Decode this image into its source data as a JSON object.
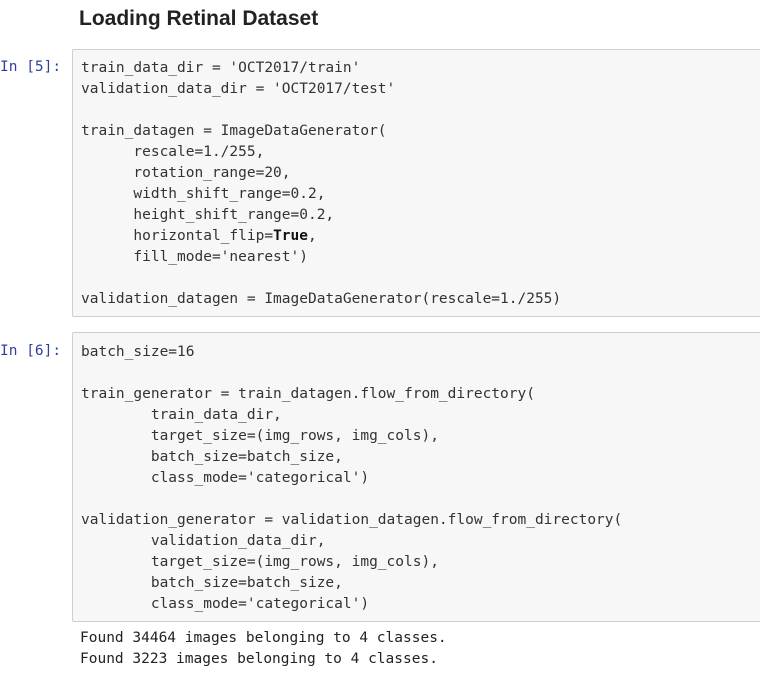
{
  "heading": "Loading Retinal Dataset",
  "cells": [
    {
      "prompt": "In [5]:",
      "lines": [
        "train_data_dir = 'OCT2017/train'",
        "validation_data_dir = 'OCT2017/test'",
        "",
        "train_datagen = ImageDataGenerator(",
        "      rescale=1./255,",
        "      rotation_range=20,",
        "      width_shift_range=0.2,",
        "      height_shift_range=0.2,",
        "      horizontal_flip=",
        "      fill_mode='nearest')",
        "",
        "validation_datagen = ImageDataGenerator(rescale=1./255)"
      ],
      "keyword_true": "True",
      "keyword_suffix": ","
    },
    {
      "prompt": "In [6]:",
      "lines": [
        "batch_size=16",
        "",
        "train_generator = train_datagen.flow_from_directory(",
        "        train_data_dir,",
        "        target_size=(img_rows, img_cols),",
        "        batch_size=batch_size,",
        "        class_mode='categorical')",
        "",
        "validation_generator = validation_datagen.flow_from_directory(",
        "        validation_data_dir,",
        "        target_size=(img_rows, img_cols),",
        "        batch_size=batch_size,",
        "        class_mode='categorical')"
      ]
    }
  ],
  "output_lines": [
    "Found 34464 images belonging to 4 classes.",
    "Found 3223 images belonging to 4 classes."
  ]
}
